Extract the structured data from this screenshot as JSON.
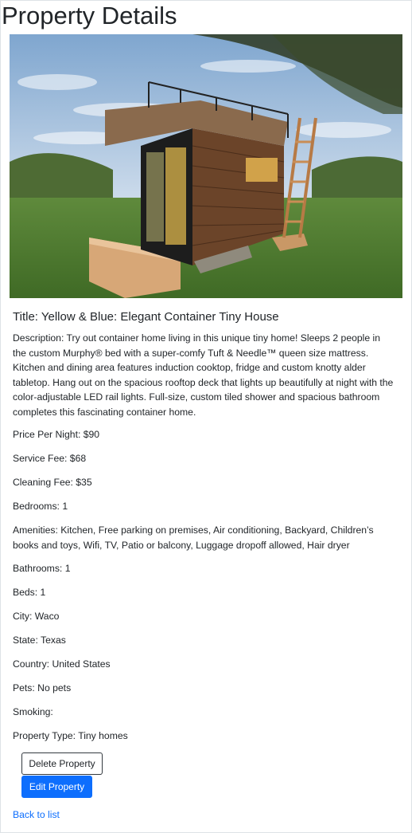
{
  "page": {
    "title": "Property Details"
  },
  "property": {
    "image_alt": "Container tiny house with rooftop deck",
    "title": "Title: Yellow & Blue: Elegant Container Tiny House",
    "description": "Description: Try out container home living in this unique tiny home! Sleeps 2 people in the custom Murphy® bed with a super-comfy Tuft & Needle™ queen size mattress. Kitchen and dining area features induction cooktop, fridge and custom knotty alder tabletop. Hang out on the spacious rooftop deck that lights up beautifully at night with the color-adjustable LED rail lights. Full-size, custom tiled shower and spacious bathroom completes this fascinating container home.",
    "price_per_night": "Price Per Night: $90",
    "service_fee": "Service Fee: $68",
    "cleaning_fee": "Cleaning Fee: $35",
    "bedrooms": "Bedrooms: 1",
    "amenities": "Amenities: Kitchen, Free parking on premises, Air conditioning, Backyard, Children’s books and toys, Wifi, TV, Patio or balcony, Luggage dropoff allowed, Hair dryer",
    "bathrooms": "Bathrooms: 1",
    "beds": "Beds: 1",
    "city": "City: Waco",
    "state": "State: Texas",
    "country": "Country: United States",
    "pets": "Pets: No pets",
    "smoking": "Smoking:",
    "property_type": "Property Type: Tiny homes"
  },
  "actions": {
    "delete_label": "Delete Property",
    "edit_label": "Edit Property",
    "back_label": "Back to list"
  },
  "colors": {
    "primary": "#0d6efd",
    "text": "#212529",
    "border": "#343a40"
  }
}
